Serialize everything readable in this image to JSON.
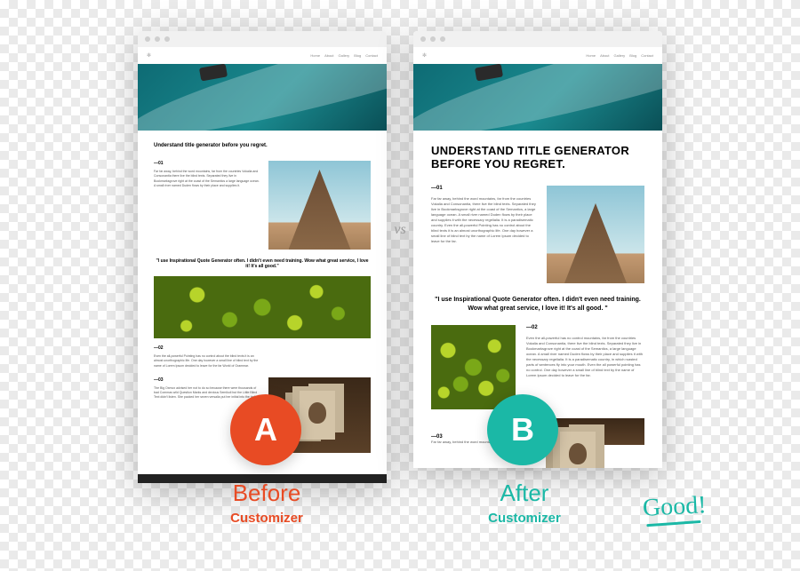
{
  "vs": "vs",
  "badges": {
    "a": "A",
    "b": "B"
  },
  "captions": {
    "before": {
      "label": "Before",
      "sub": "Customizer"
    },
    "after": {
      "label": "After",
      "sub": "Customizer"
    }
  },
  "good": "Good!",
  "nav": {
    "logo": "✻",
    "items": [
      "Home",
      "About",
      "Gallery",
      "Blog",
      "Contact"
    ]
  },
  "before": {
    "heading": "Understand title generator before you regret.",
    "s1_label": "—01",
    "s1_body": "Far far away, behind the word mountains, far from the countries Vokalia and Consonantia there live the blind texts. Separated they live in Bookmarksgrove right at the coast of the Semantics a large language ocean. A small river named Duden flows by their place and supplies it.",
    "quote": "\"I use Inspirational Quote Generator often. I didn't even need training. Wow what great service, I love it! It's all good.\"",
    "s2_label": "—02",
    "s2_body": "Even the all-powerful Pointing has no control about the blind texts it is an almost unorthographic life. One day however a small line of blind text by the name of Lorem Ipsum decided to leave for the far World of Grammar.",
    "s3_label": "—03",
    "s3_body": "The Big Oxmox advised her not to do so because there were thousands of bad Commas wild Question Marks and devious Semikoli but the Little Blind Text didn't listen. She packed her seven versalia put her initial into the belt."
  },
  "after": {
    "heading": "Understand title generator before you regret.",
    "s1_label": "—01",
    "s1_body": "Far far away, behind the word mountains, far from the countries Vokalia and Consonantia, there live the blind texts. Separated they live in Bookmarksgrove right at the coast of the Semantics, a large language ocean. A small river named Duden flows by their place and supplies it with the necessary regelialia. It is a paradisematic country. Even the all-powerful Pointing has no control about the blind texts it is an almost unorthographic life. One day however a small line of blind text by the name of Lorem Ipsum decided to leave for the far.",
    "quote": "\"I use Inspirational Quote Generator often. I didn't even need training. Wow what great service, I love it! It's all good. \"",
    "s2_label": "—02",
    "s2_body": "Even the all-powerful has no control mountains, far from the countries Vokalia and Consonantia, there live the blind texts. Separated they live in Bookmarksgrove right at the coast of the Semantics, a large language ocean. A small river named Duden flows by their place and supplies it with the necessary regelialia. It is a paradisematic country, in which roasted parts of sentences fly into your mouth. Even the all powerful pointing has no control. One day however a small line of blind text by the name of Lorem Ipsum decided to leave for the far.",
    "s3_label": "—03",
    "s3_body": "Far far away, behind the word mountains, far from the"
  }
}
